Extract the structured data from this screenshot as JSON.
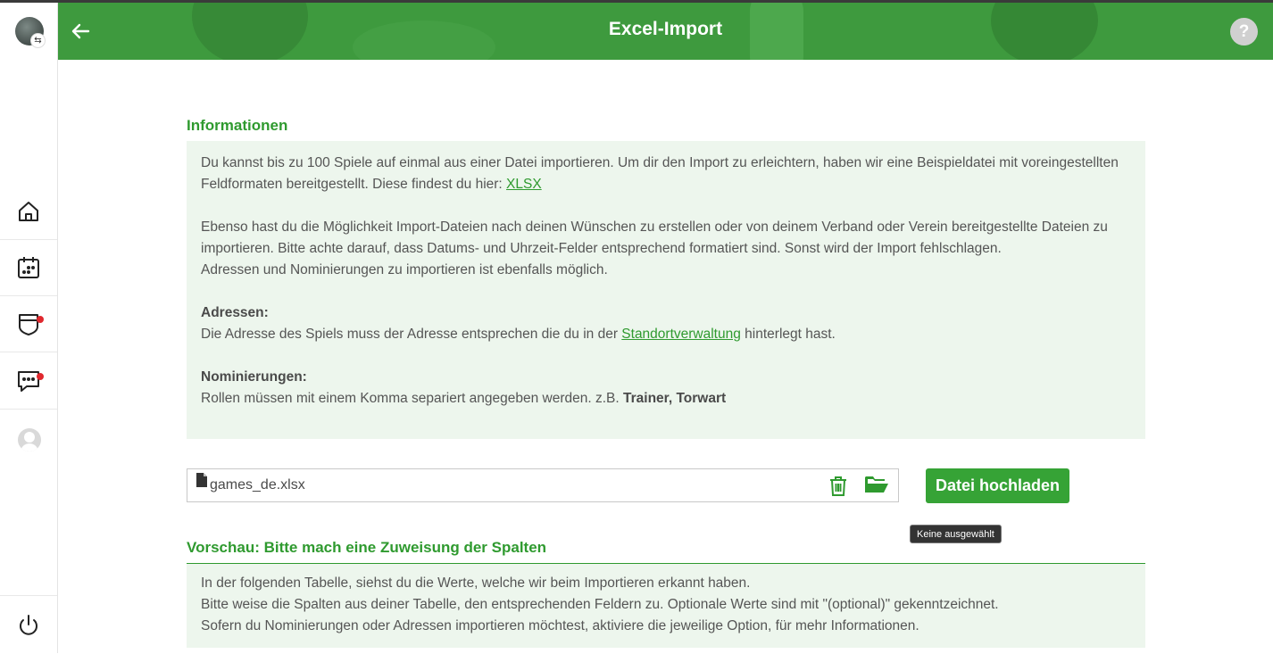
{
  "header": {
    "title": "Excel-Import",
    "back_icon": "arrow-left-icon",
    "help_label": "?"
  },
  "sidebar": {
    "switch_label": "⇆",
    "items": [
      {
        "name": "home",
        "icon": "home-icon"
      },
      {
        "name": "calendar",
        "icon": "calendar-icon"
      },
      {
        "name": "teams",
        "icon": "shield-icon",
        "notification": true
      },
      {
        "name": "messages",
        "icon": "chat-icon",
        "notification": true
      },
      {
        "name": "profile",
        "icon": "user-icon"
      }
    ],
    "logout_icon": "power-icon"
  },
  "info": {
    "title": "Informationen",
    "p1": "Du kannst bis zu 100 Spiele auf einmal aus einer Datei importieren. Um dir den Import zu erleichtern, haben wir eine Beispieldatei mit voreingestellten Feldformaten bereitgestellt. Diese findest du hier: ",
    "p1_link": "XLSX",
    "p2": "Ebenso hast du die Möglichkeit Import-Dateien nach deinen Wünschen zu erstellen oder von deinem Verband oder Verein bereitgestellte Dateien zu importieren. Bitte achte darauf, dass Datums- und Uhrzeit-Felder entsprechend formatiert sind. Sonst wird der Import fehlschlagen.",
    "p3": "Adressen und Nominierungen zu importieren ist ebenfalls möglich.",
    "addresses_heading": "Adressen:",
    "addresses_text_before": "Die Adresse des Spiels muss der Adresse entsprechen die du in der ",
    "addresses_link": "Standortverwaltung",
    "addresses_text_after": " hinterlegt hast.",
    "nominations_heading": "Nominierungen:",
    "nominations_text": "Rollen müssen mit einem Komma separiert angegeben werden. z.B. ",
    "nominations_example": "Trainer, Torwart"
  },
  "upload": {
    "file_name": "games_de.xlsx",
    "button_label": "Datei hochladen",
    "tooltip": "Keine ausgewählt"
  },
  "preview": {
    "title": "Vorschau: Bitte mach eine Zuweisung der Spalten",
    "line1": "In der folgenden Tabelle, siehst du die Werte, welche wir beim Importieren erkannt haben.",
    "line2": "Bitte weise die Spalten aus deiner Tabelle, den entsprechenden Feldern zu. Optionale Werte sind mit \"(optional)\" gekenntzeichnet.",
    "line3": "Sofern du Nominierungen oder Adressen importieren möchtest, aktiviere die jeweilige Option, für mehr Informationen."
  },
  "colors": {
    "brand_green": "#3e9a3e",
    "accent_green": "#2f9a2f",
    "info_bg": "#edf6ed",
    "notification_red": "#e0282e"
  }
}
